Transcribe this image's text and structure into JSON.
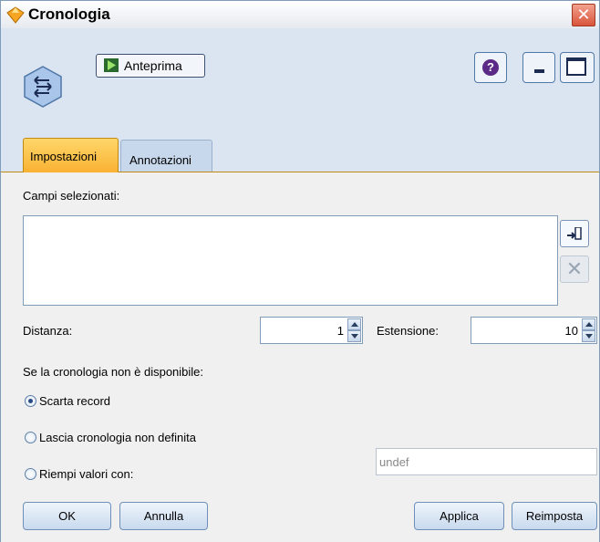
{
  "window": {
    "title": "Cronologia",
    "close_symbol": "✕"
  },
  "toolbar": {
    "preview_label": "Anteprima",
    "help_symbol": "?"
  },
  "tabs": [
    {
      "label": "Impostazioni",
      "active": true
    },
    {
      "label": "Annotazioni",
      "active": false
    }
  ],
  "settings": {
    "selected_fields_label": "Campi selezionati:",
    "selected_fields": [],
    "remove_symbol": "✕",
    "offset_label": "Distanza:",
    "offset_value": "1",
    "span_label": "Estensione:",
    "span_value": "10",
    "unavailable_label": "Se la cronologia non è disponibile:",
    "options": [
      {
        "label": "Scarta record",
        "selected": true
      },
      {
        "label": "Lascia cronologia non definita",
        "selected": false
      },
      {
        "label": "Riempi valori con:",
        "selected": false
      }
    ],
    "fill_value": "undef"
  },
  "buttons": {
    "ok": "OK",
    "cancel": "Annulla",
    "apply": "Applica",
    "reset": "Reimposta"
  },
  "colors": {
    "active_tab": "#f9b233",
    "header_bg": "#dbe5f1",
    "close": "#d9543a"
  }
}
